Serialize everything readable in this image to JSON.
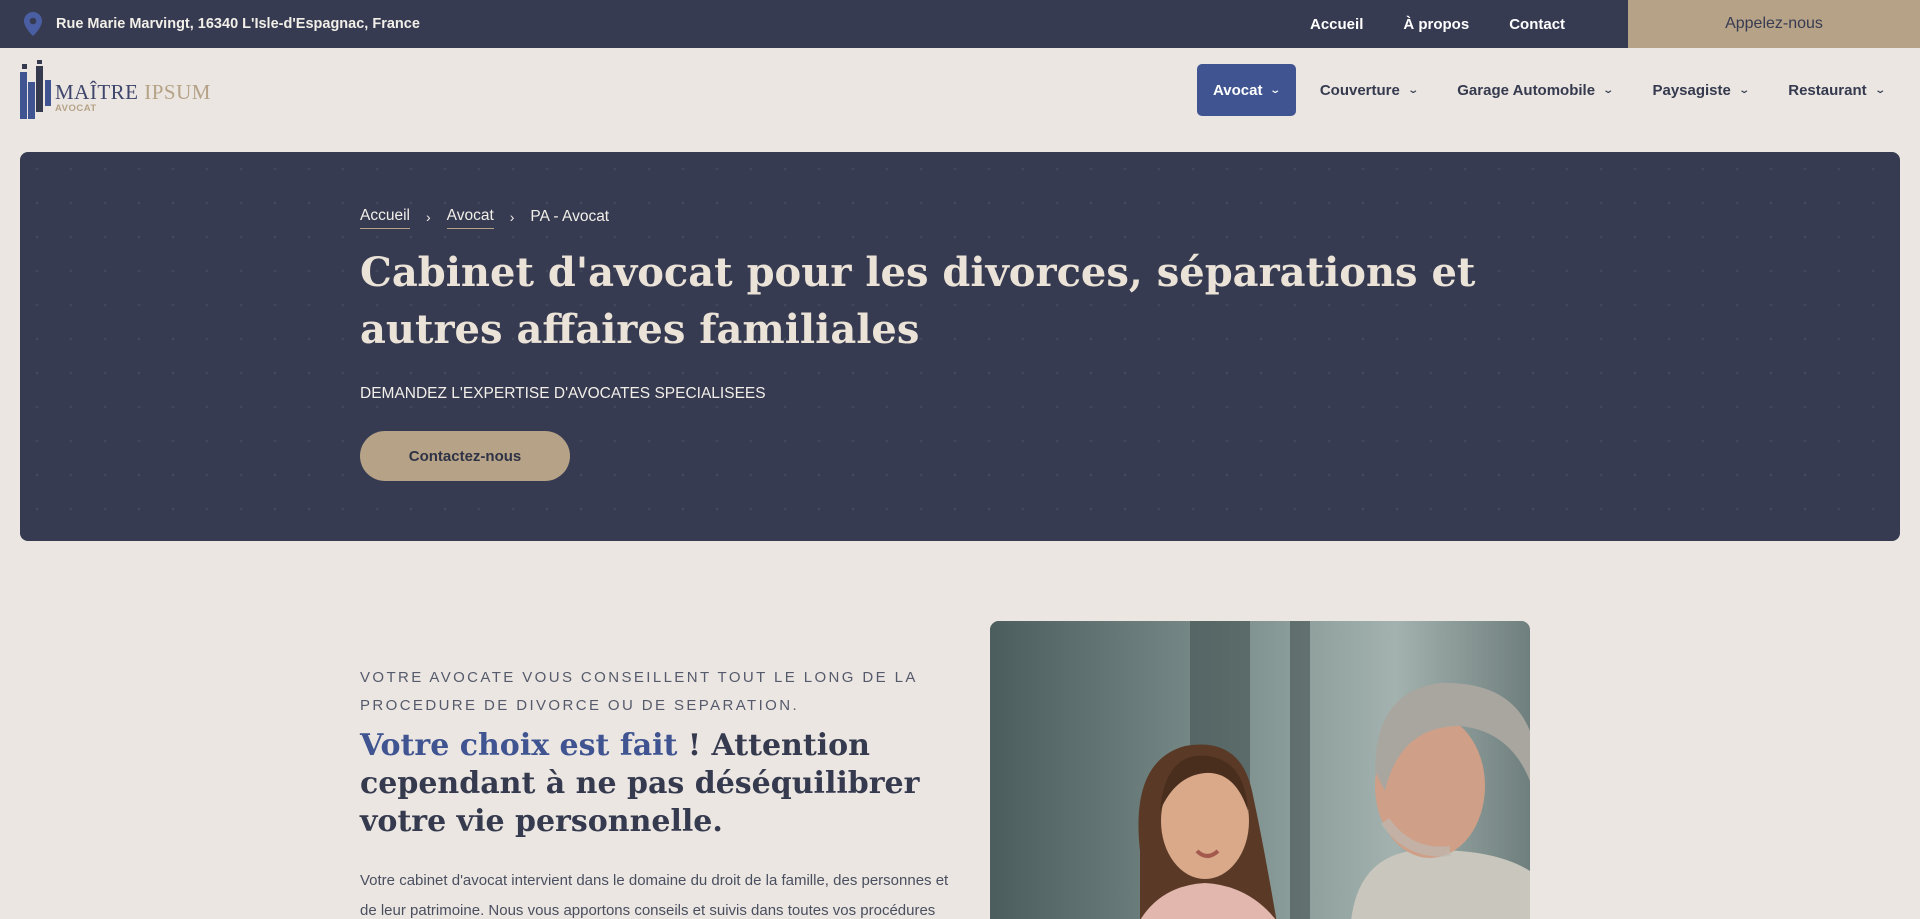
{
  "topbar": {
    "address": "Rue Marie Marvingt, 16340 L'Isle-d'Espagnac, France",
    "links": [
      "Accueil",
      "À propos",
      "Contact"
    ],
    "call_label": "Appelez-nous"
  },
  "logo": {
    "name_a": "MAÎTRE",
    "name_b": "IPSUM",
    "sub": "AVOCAT"
  },
  "nav": {
    "items": [
      {
        "label": "Avocat",
        "active": true
      },
      {
        "label": "Couverture"
      },
      {
        "label": "Garage Automobile"
      },
      {
        "label": "Paysagiste"
      },
      {
        "label": "Restaurant"
      }
    ]
  },
  "hero": {
    "breadcrumb": {
      "home": "Accueil",
      "section": "Avocat",
      "current": "PA - Avocat"
    },
    "title": "Cabinet d'avocat pour les divorces, séparations et autres affaires familiales",
    "tagline": "DEMANDEZ L'EXPERTISE D'AVOCATES SPECIALISEES",
    "cta": "Contactez-nous"
  },
  "content": {
    "kicker": "VOTRE AVOCATE VOUS CONSEILLENT TOUT LE LONG DE LA PROCEDURE DE DIVORCE OU DE SEPARATION.",
    "heading_highlight": "Votre choix est fait",
    "heading_rest": " ! Attention cependant à ne pas déséquilibrer votre vie personnelle.",
    "body": "Votre cabinet d'avocat intervient dans le domaine du droit de la famille, des personnes et de leur patrimoine. Nous vous apportons conseils et suivis dans toutes vos procédures"
  },
  "colors": {
    "navy": "#373b51",
    "accent_blue": "#3f5491",
    "gold": "#b5a287",
    "background": "#ebe6e1"
  },
  "icons": {
    "address": "map-pin-icon",
    "dropdown": "chevron-down-icon",
    "breadcrumb_separator": "chevron-right-icon"
  }
}
